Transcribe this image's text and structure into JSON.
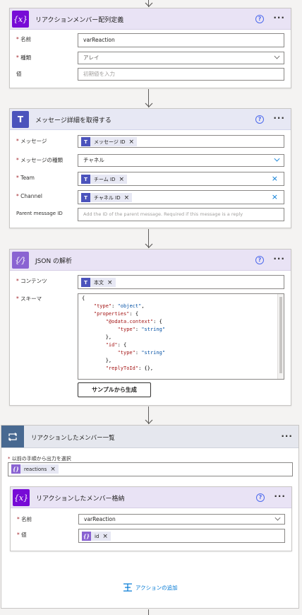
{
  "card1": {
    "title": "リアクションメンバー配列定義",
    "help": "?",
    "more": "···",
    "tile_icon": "{x}",
    "name_label": "名前",
    "name_value": "varReaction",
    "type_label": "種類",
    "type_value": "アレイ",
    "value_label": "値",
    "value_placeholder": "初期値を入力"
  },
  "card2": {
    "title": "メッセージ詳細を取得する",
    "help": "?",
    "more": "···",
    "message_label": "メッセージ",
    "message_token": "メッセージ ID",
    "message_type_label": "メッセージの種類",
    "message_type_value": "チャネル",
    "team_label": "Team",
    "team_token": "チーム ID",
    "channel_label": "Channel",
    "channel_token": "チャネル ID",
    "parent_label": "Parent message ID",
    "parent_placeholder": "Add the ID of the parent message. Required if this message is a reply"
  },
  "card3": {
    "title": "JSON の解析",
    "help": "?",
    "more": "···",
    "content_label": "コンテンツ",
    "content_token": "本文",
    "schema_label": "スキーマ",
    "sample_button": "サンプルから生成"
  },
  "loop": {
    "title": "リアクションしたメンバー一覧",
    "more": "···",
    "select_label": "以前の手順から出力を選択",
    "select_token": "reactions",
    "add_action": "アクションの追加"
  },
  "card4": {
    "title": "リアクションしたメンバー格納",
    "help": "?",
    "more": "···",
    "name_label": "名前",
    "name_value": "varReaction",
    "value_label": "値",
    "value_token": "id"
  },
  "colors": {
    "variable_purple": "#770bd6",
    "json_purple": "#8a63d2",
    "teams_blue": "#4b53bc",
    "loop_blue": "#486991",
    "link_blue": "#0078d4"
  }
}
